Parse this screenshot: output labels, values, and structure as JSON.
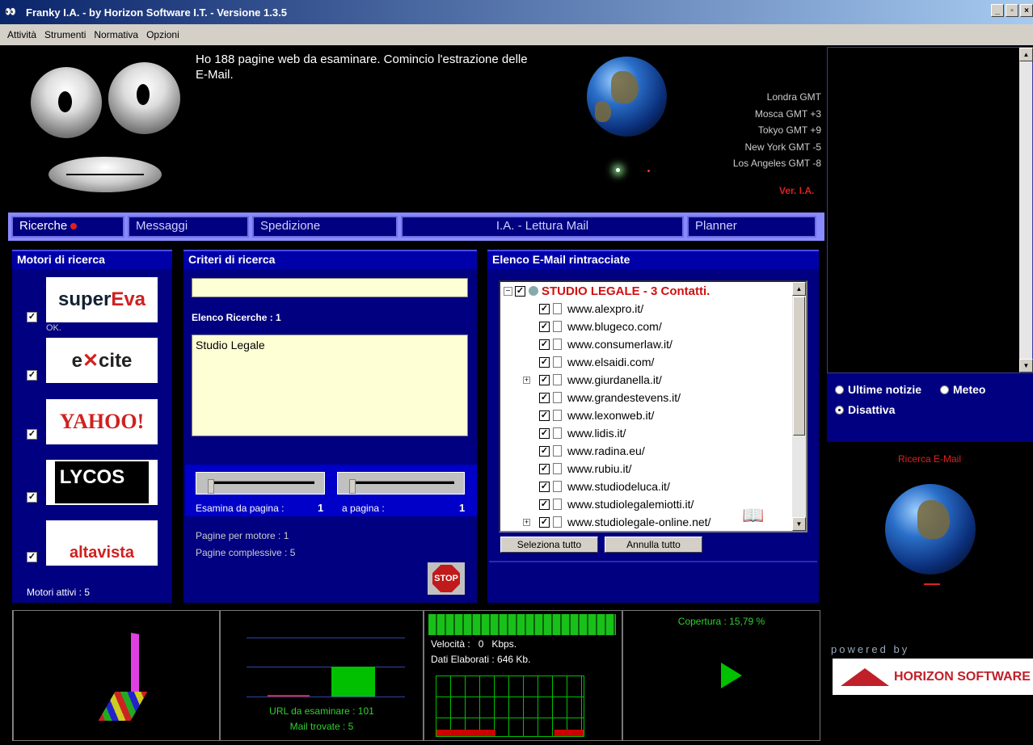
{
  "window": {
    "title": "Franky I.A. - by Horizon Software I.T. - Versione 1.3.5",
    "app_icon": "eyes-icon"
  },
  "menu": [
    "Attività",
    "Strumenti",
    "Normativa",
    "Opzioni"
  ],
  "face": {
    "message": "Ho 188 pagine web da esaminare. Comincio l'estrazione delle E-Mail."
  },
  "timezones": [
    "Londra GMT",
    "Mosca GMT +3",
    "Tokyo GMT +9",
    "New York GMT -5",
    "Los Angeles GMT -8"
  ],
  "version_label": "Ver. I.A.",
  "tabs": [
    {
      "label": "Ricerche"
    },
    {
      "label": "Messaggi"
    },
    {
      "label": "Spedizione"
    },
    {
      "label": "I.A. - Lettura Mail"
    },
    {
      "label": "Planner"
    }
  ],
  "engines": {
    "title": "Motori di ricerca",
    "status": "OK.",
    "active": "Motori attivi : 5",
    "items": [
      {
        "name": "superEva",
        "checked": true
      },
      {
        "name": "excite",
        "checked": true
      },
      {
        "name": "YAHOO!",
        "checked": true
      },
      {
        "name": "LYCOS",
        "checked": true
      },
      {
        "name": "altavista",
        "checked": true
      }
    ]
  },
  "criteria": {
    "title": "Criteri di ricerca",
    "search_value": "",
    "list_label": "Elenco Ricerche : 1",
    "list_items": [
      "Studio Legale"
    ],
    "from_label": "Esamina da pagina :",
    "from_value": "1",
    "to_label": "a pagina :",
    "to_value": "1",
    "per_engine": "Pagine per motore : 1",
    "total": "Pagine complessive : 5",
    "stop_label": "STOP"
  },
  "emails": {
    "title": "Elenco E-Mail rintracciate",
    "root": "STUDIO LEGALE - 3 Contatti.",
    "sites": [
      "www.alexpro.it/",
      "www.blugeco.com/",
      "www.consumerlaw.it/",
      "www.elsaidi.com/",
      "www.giurdanella.it/",
      "www.grandestevens.it/",
      "www.lexonweb.it/",
      "www.lidis.it/",
      "www.radina.eu/",
      "www.rubiu.it/",
      "www.studiodeluca.it/",
      "www.studiolegalemiotti.it/",
      "www.studiolegale-online.net/"
    ],
    "select_all": "Seleziona tutto",
    "deselect_all": "Annulla tutto"
  },
  "news": {
    "option1": "Ultime notizie",
    "option2": "Meteo",
    "option3": "Disattiva",
    "selected": "Disattiva"
  },
  "search_globe_label": "Ricerca E-Mail",
  "stats": {
    "url_label": "URL da esaminare : 101",
    "mail_label": "Mail trovate : 5",
    "speed": "Velocità :   0   Kbps.",
    "data": "Dati Elaborati : 646 Kb.",
    "coverage": "Copertura : 15,79 %",
    "coverage_fraction": 0.1579
  },
  "brand": {
    "powered": "powered by",
    "logo": "HORIZON SOFTWARE"
  }
}
